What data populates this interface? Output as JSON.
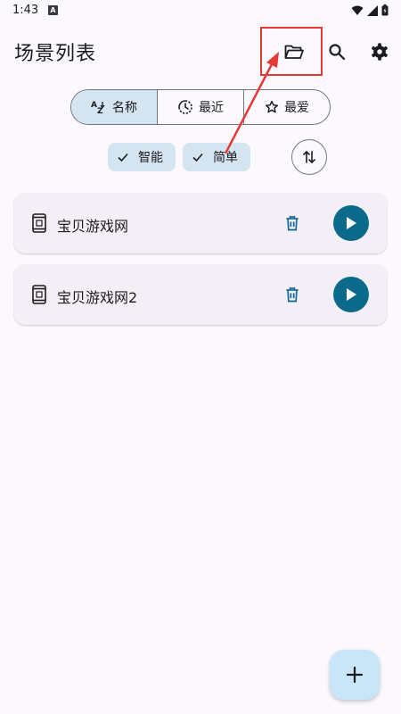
{
  "status_bar": {
    "time": "1:43",
    "badge": "A"
  },
  "app_bar": {
    "title": "场景列表",
    "icons": [
      "folder-open-icon",
      "search-icon",
      "settings-icon"
    ]
  },
  "sort_tabs": [
    {
      "label": "名称",
      "icon": "sort-az-icon",
      "selected": true
    },
    {
      "label": "最近",
      "icon": "clock-icon",
      "selected": false
    },
    {
      "label": "最爱",
      "icon": "star-icon",
      "selected": false
    }
  ],
  "filter_chips": [
    {
      "label": "智能",
      "checked": true
    },
    {
      "label": "简单",
      "checked": true
    }
  ],
  "scenes": [
    {
      "name": "宝贝游戏网"
    },
    {
      "name": "宝贝游戏网2"
    }
  ],
  "colors": {
    "accent": "#0B6A8C",
    "chip_bg": "#D4E4F1",
    "card_bg": "#F4EFF7",
    "fab_bg": "#C8E6F8",
    "highlight": "#E53935"
  }
}
